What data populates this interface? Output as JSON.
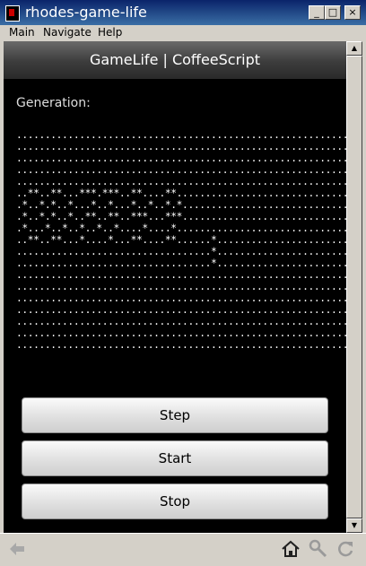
{
  "window": {
    "title": "rhodes-game-life",
    "minimize": "_",
    "maximize": "□",
    "close": "×"
  },
  "menu": [
    "Main",
    "Navigate",
    "Help"
  ],
  "app": {
    "title": "GameLife | CoffeeScript",
    "generation_label": "Generation:"
  },
  "grid": [
    "............................................................",
    "............................................................",
    "............................................................",
    "............................................................",
    "............................................................",
    "..**..**...***.***..**....**................................",
    ".*..*.*..*...*..*...*..*..*.*...............................",
    ".*..*.*..*..**..**..***...***...............................",
    ".*...*..*..*..*..*....*....*................................",
    "..**..**...*....*...**....**......*.........................",
    "..................................*.........................",
    "..................................*.........................",
    "............................................................",
    "............................................................",
    "............................................................",
    "............................................................",
    "............................................................",
    "............................................................",
    "............................................................"
  ],
  "buttons": {
    "step": "Step",
    "start": "Start",
    "stop": "Stop"
  },
  "icons": {
    "back": "back-arrow-icon",
    "home": "home-icon",
    "options": "wrench-icon",
    "refresh": "refresh-icon"
  }
}
